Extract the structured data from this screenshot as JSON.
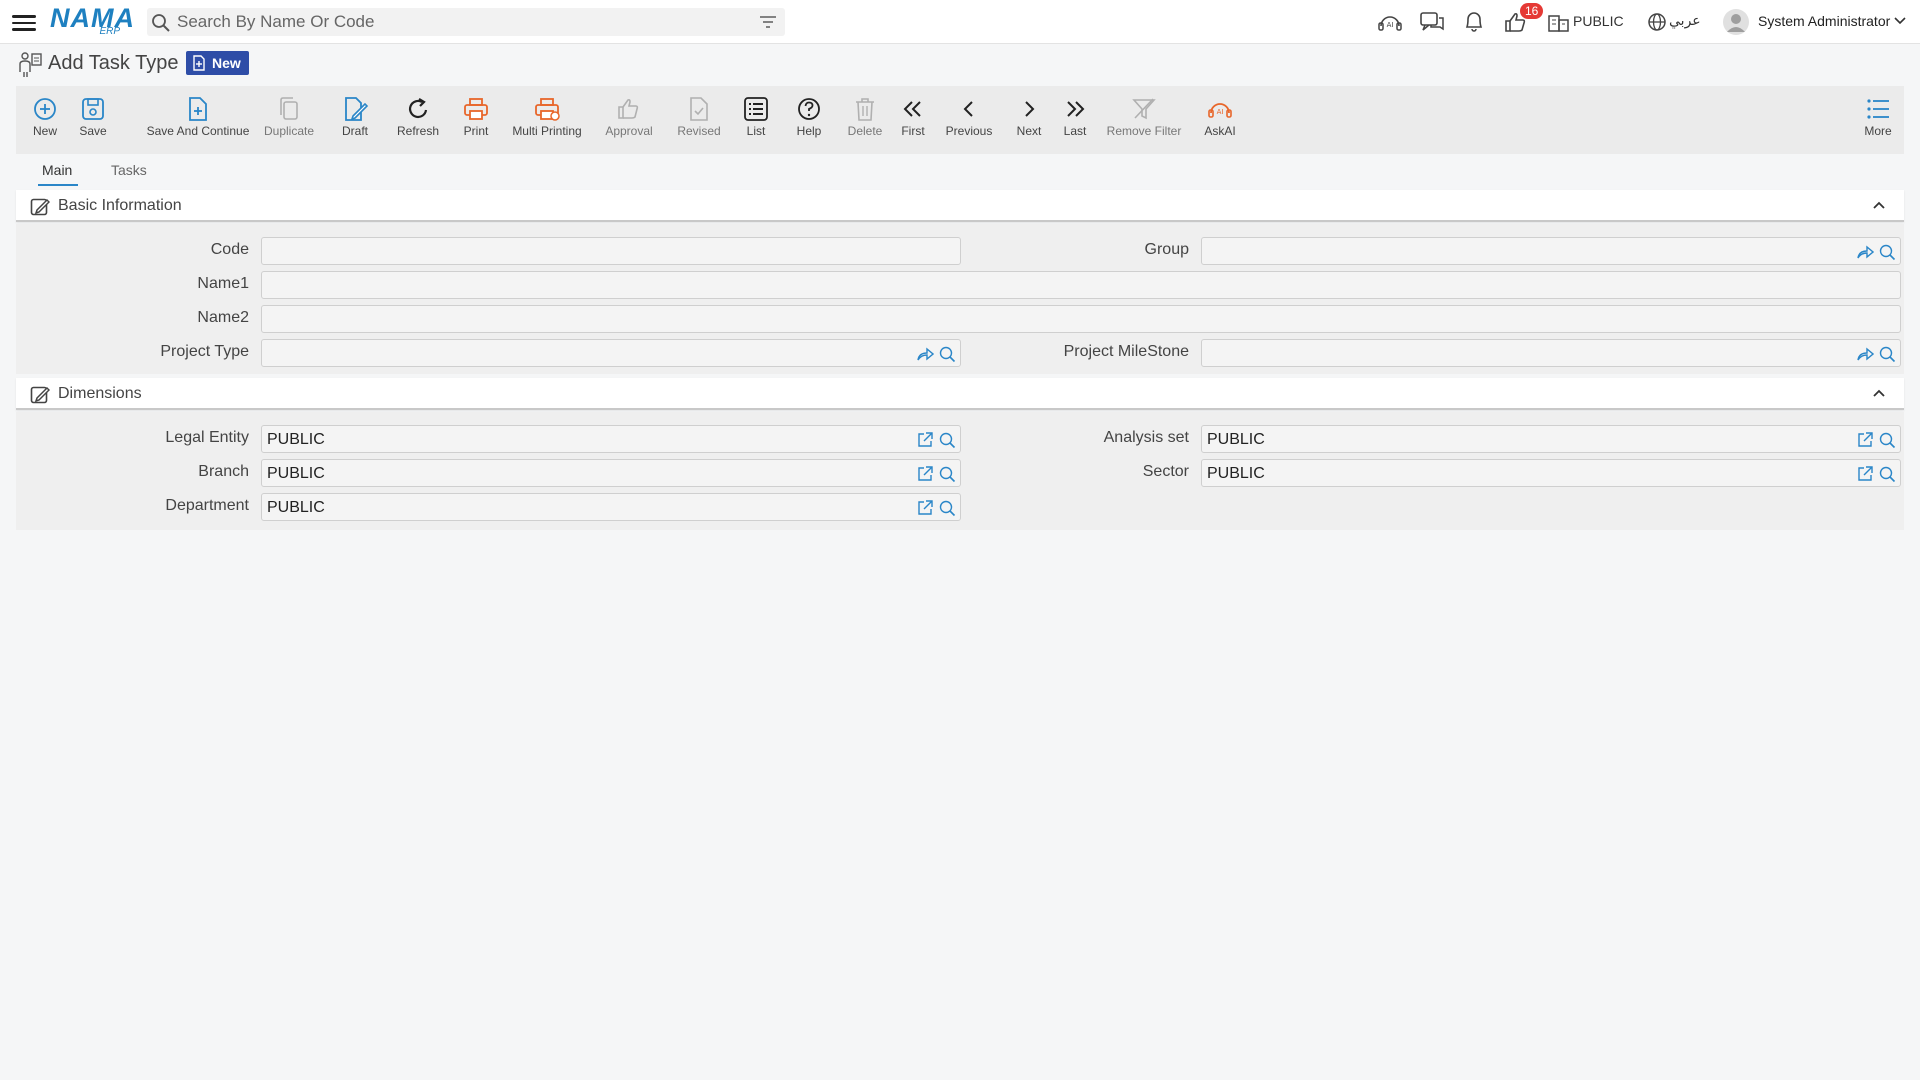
{
  "app": {
    "logo_text": "NAMA",
    "logo_sub": "ERP",
    "search_placeholder": "Search By Name Or Code",
    "notification_count": "16",
    "organization": "PUBLIC",
    "language": "عربي",
    "user_name": "System Administrator"
  },
  "page": {
    "title": "Add Task Type",
    "status_tag": "New"
  },
  "toolbar": {
    "new": "New",
    "save": "Save",
    "save_continue": "Save And Continue",
    "duplicate": "Duplicate",
    "draft": "Draft",
    "refresh": "Refresh",
    "print": "Print",
    "multi_printing": "Multi Printing",
    "approval": "Approval",
    "revised": "Revised",
    "list": "List",
    "help": "Help",
    "delete": "Delete",
    "first": "First",
    "previous": "Previous",
    "next": "Next",
    "last": "Last",
    "remove_filter": "Remove Filter",
    "askai": "AskAI",
    "more": "More"
  },
  "tabs": {
    "main": "Main",
    "tasks": "Tasks"
  },
  "basic_info": {
    "title": "Basic Information",
    "code_label": "Code",
    "code_value": "",
    "group_label": "Group",
    "group_value": "",
    "name1_label": "Name1",
    "name1_value": "",
    "name2_label": "Name2",
    "name2_value": "",
    "project_type_label": "Project Type",
    "project_type_value": "",
    "project_milestone_label": "Project MileStone",
    "project_milestone_value": ""
  },
  "dimensions": {
    "title": "Dimensions",
    "legal_entity_label": "Legal Entity",
    "legal_entity_value": "PUBLIC",
    "analysis_set_label": "Analysis set",
    "analysis_set_value": "PUBLIC",
    "branch_label": "Branch",
    "branch_value": "PUBLIC",
    "sector_label": "Sector",
    "sector_value": "PUBLIC",
    "department_label": "Department",
    "department_value": "PUBLIC"
  },
  "colors": {
    "accent_blue": "#2a86c8",
    "print_orange": "#e8662a",
    "badge_red": "#e53935",
    "tag_blue": "#2e4da7"
  }
}
